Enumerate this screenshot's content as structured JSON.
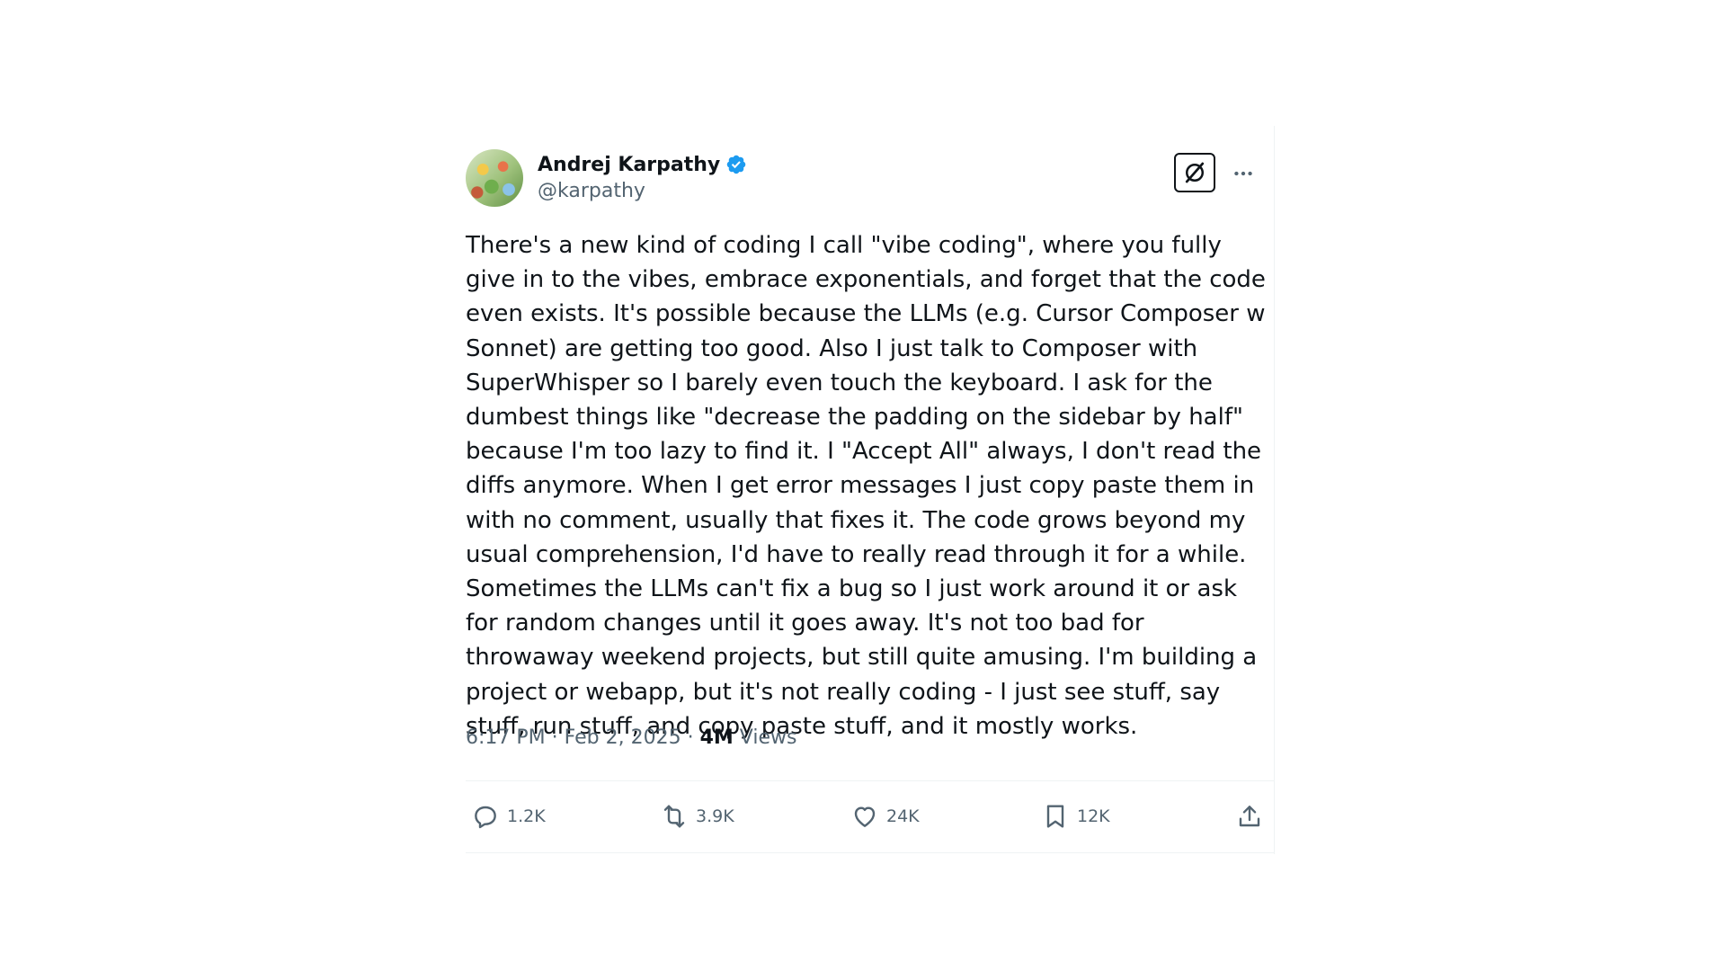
{
  "tweet": {
    "author": {
      "display_name": "Andrej Karpathy",
      "handle": "@karpathy",
      "verified": true,
      "verified_color": "#1d9bf0"
    },
    "text": "There's a new kind of coding I call \"vibe coding\", where you fully give in to the vibes, embrace exponentials, and forget that the code even exists. It's possible because the LLMs (e.g. Cursor Composer w Sonnet) are getting too good. Also I just talk to Composer with SuperWhisper so I barely even touch the keyboard. I ask for the dumbest things like \"decrease the padding on the sidebar by half\" because I'm too lazy to find it. I \"Accept All\" always, I don't read the diffs anymore. When I get error messages I just copy paste them in with no comment, usually that fixes it. The code grows beyond my usual comprehension, I'd have to really read through it for a while. Sometimes the LLMs can't fix a bug so I just work around it or ask for random changes until it goes away. It's not too bad for throwaway weekend projects, but still quite amusing. I'm building a project or webapp, but it's not really coding - I just see stuff, say stuff, run stuff, and copy paste stuff, and it mostly works.",
    "time": "6:17 PM",
    "separator": "·",
    "date": "Feb 2, 2025",
    "views_count": "4M",
    "views_label": "Views",
    "actions": {
      "replies": "1.2K",
      "reposts": "3.9K",
      "likes": "24K",
      "bookmarks": "12K"
    }
  },
  "icons": {
    "verified": "verified-badge-icon",
    "grok": "grok-icon",
    "more": "more-dots-icon",
    "reply": "reply-icon",
    "repost": "repost-icon",
    "like": "heart-icon",
    "bookmark": "bookmark-icon",
    "share": "share-icon"
  },
  "colors": {
    "text_primary": "#0f1419",
    "text_secondary": "#536471",
    "divider": "#eff3f4",
    "verified": "#1d9bf0"
  }
}
